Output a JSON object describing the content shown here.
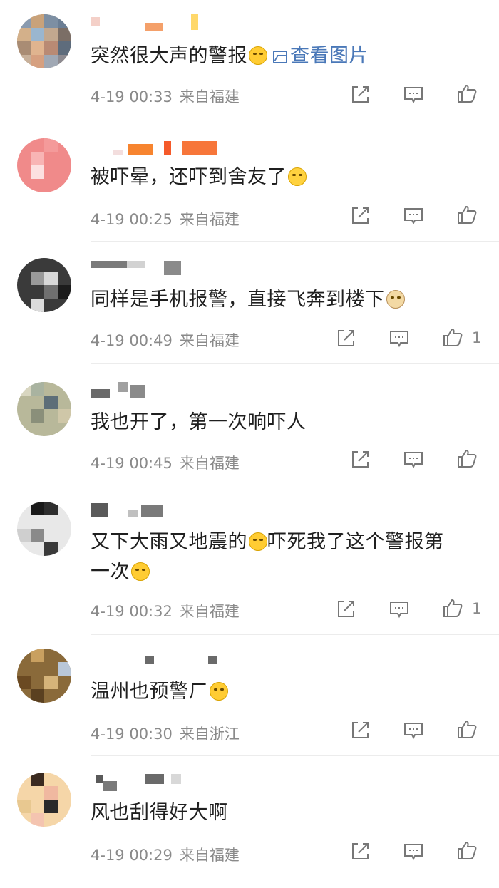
{
  "comments": [
    {
      "text": "突然很大声的警报",
      "emoji": "😂",
      "view_pic": "查看图片",
      "date": "4-19 00:33",
      "source": "来自福建",
      "likes": ""
    },
    {
      "text": "被吓晕，还吓到舍友了",
      "emoji": "😭",
      "date": "4-19 00:25",
      "source": "来自福建",
      "likes": ""
    },
    {
      "text": "同样是手机报警，直接飞奔到楼下",
      "emoji": "🐶",
      "date": "4-19 00:49",
      "source": "来自福建",
      "likes": "1"
    },
    {
      "text": "我也开了，第一次响吓人",
      "date": "4-19 00:45",
      "source": "来自福建",
      "likes": ""
    },
    {
      "text_line1": "又下大雨又地震的",
      "emoji1": "😂",
      "text_line1b": "吓死我了这个警报第",
      "text_line2": "一次",
      "emoji2": "😂",
      "date": "4-19 00:32",
      "source": "来自福建",
      "likes": "1"
    },
    {
      "text": "温州也预警ㄏ",
      "emoji": "😂",
      "date": "4-19 00:30",
      "source": "来自浙江",
      "likes": ""
    },
    {
      "text": "风也刮得好大啊",
      "date": "4-19 00:29",
      "source": "来自福建",
      "likes": ""
    }
  ],
  "icons": {
    "share": "share-icon",
    "comment": "comment-icon",
    "like": "thumbs-up-icon"
  }
}
